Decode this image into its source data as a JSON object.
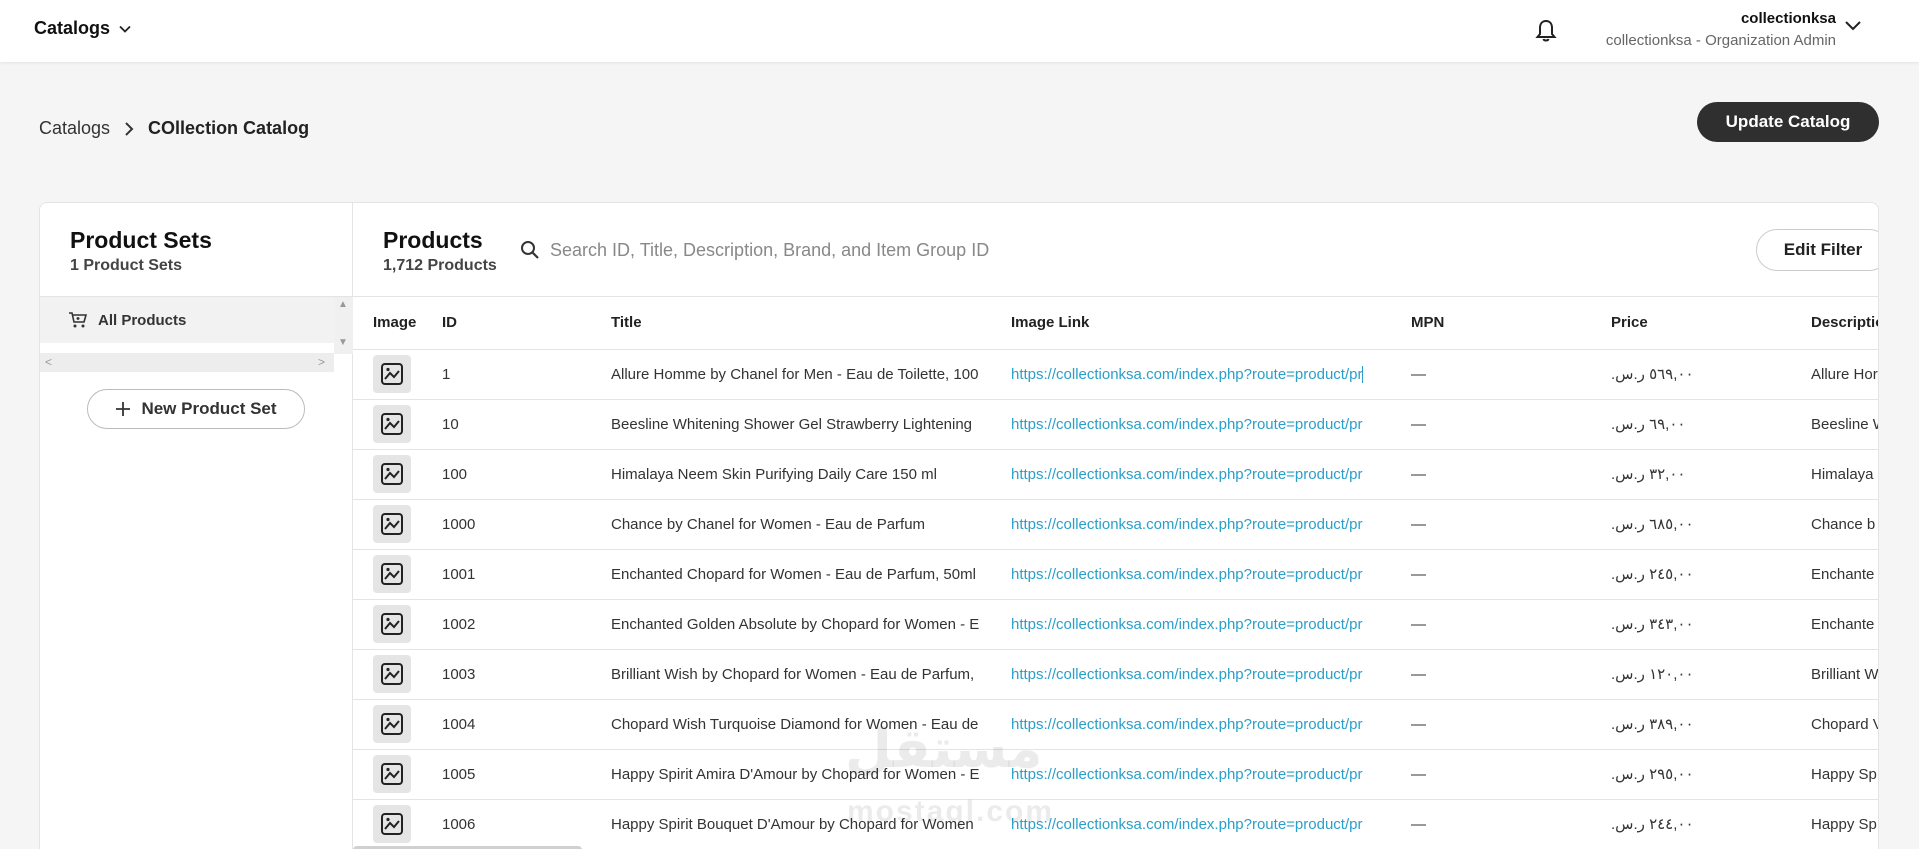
{
  "topbar": {
    "catalogs_label": "Catalogs",
    "user_name": "collectionksa",
    "user_role": "collectionksa - Organization Admin"
  },
  "breadcrumb": {
    "root": "Catalogs",
    "current": "COllection Catalog"
  },
  "update_button": "Update Catalog",
  "product_sets": {
    "title": "Product Sets",
    "count": "1 Product Sets",
    "items": [
      {
        "label": "All Products"
      }
    ],
    "new_button": "New Product Set"
  },
  "products": {
    "title": "Products",
    "count": "1,712 Products",
    "search_placeholder": "Search ID, Title, Description, Brand, and Item Group ID",
    "edit_filter": "Edit Filter",
    "columns": [
      "Image",
      "ID",
      "Title",
      "Image Link",
      "MPN",
      "Price",
      "Descriptio"
    ],
    "rows": [
      {
        "id": "1",
        "title": "Allure Homme by Chanel for Men - Eau de Toilette, 100",
        "link": "https://collectionksa.com/index.php?route=product/pr",
        "mpn": "—",
        "price": "٥٦٩,٠٠ ر.س.",
        "desc": "Allure Hor"
      },
      {
        "id": "10",
        "title": "Beesline Whitening Shower Gel Strawberry Lightening",
        "link": "https://collectionksa.com/index.php?route=product/pr",
        "mpn": "—",
        "price": "٦٩,٠٠ ر.س.",
        "desc": "Beesline W"
      },
      {
        "id": "100",
        "title": "Himalaya Neem Skin Purifying Daily Care 150 ml",
        "link": "https://collectionksa.com/index.php?route=product/pr",
        "mpn": "—",
        "price": "٣٢,٠٠ ر.س.",
        "desc": "Himalaya"
      },
      {
        "id": "1000",
        "title": "Chance by Chanel for Women - Eau de Parfum",
        "link": "https://collectionksa.com/index.php?route=product/pr",
        "mpn": "—",
        "price": "٦٨٥,٠٠ ر.س.",
        "desc": "Chance b"
      },
      {
        "id": "1001",
        "title": "Enchanted Chopard for Women - Eau de Parfum, 50ml",
        "link": "https://collectionksa.com/index.php?route=product/pr",
        "mpn": "—",
        "price": "٢٤٥,٠٠ ر.س.",
        "desc": "Enchante"
      },
      {
        "id": "1002",
        "title": "Enchanted Golden Absolute by Chopard for Women - E",
        "link": "https://collectionksa.com/index.php?route=product/pr",
        "mpn": "—",
        "price": "٣٤٣,٠٠ ر.س.",
        "desc": "Enchante"
      },
      {
        "id": "1003",
        "title": "Brilliant Wish by Chopard for Women - Eau de Parfum,",
        "link": "https://collectionksa.com/index.php?route=product/pr",
        "mpn": "—",
        "price": "١٢٠,٠٠ ر.س.",
        "desc": "Brilliant W"
      },
      {
        "id": "1004",
        "title": "Chopard Wish Turquoise Diamond for Women - Eau de",
        "link": "https://collectionksa.com/index.php?route=product/pr",
        "mpn": "—",
        "price": "٣٨٩,٠٠ ر.س.",
        "desc": "Chopard V"
      },
      {
        "id": "1005",
        "title": "Happy Spirit Amira D'Amour by Chopard for Women - E",
        "link": "https://collectionksa.com/index.php?route=product/pr",
        "mpn": "—",
        "price": "٢٩٥,٠٠ ر.س.",
        "desc": "Happy Sp"
      },
      {
        "id": "1006",
        "title": "Happy Spirit Bouquet D'Amour by Chopard for Women",
        "link": "https://collectionksa.com/index.php?route=product/pr",
        "mpn": "—",
        "price": "٢٤٤,٠٠ ر.س.",
        "desc": "Happy Sp"
      }
    ]
  },
  "watermark": {
    "arabic": "مستقل",
    "latin": "mostaql.com"
  },
  "colors": {
    "link": "#2a9fc9",
    "primary_button": "#2f2f2f"
  }
}
